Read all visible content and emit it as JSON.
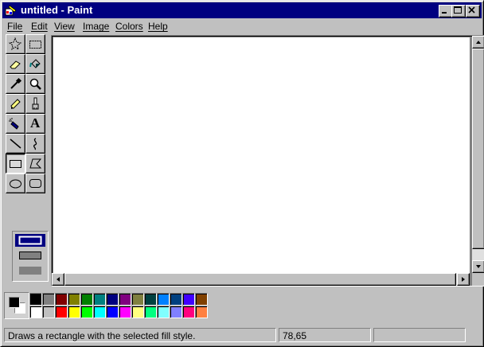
{
  "window": {
    "title": "untitled - Paint",
    "colors": {
      "titlebar": "#000080",
      "face": "#c0c0c0",
      "canvas": "#ffffff"
    }
  },
  "menu": {
    "items": [
      {
        "label": "File",
        "id": "file"
      },
      {
        "label": "Edit",
        "id": "edit"
      },
      {
        "label": "View",
        "id": "view"
      },
      {
        "label": "Image",
        "id": "image"
      },
      {
        "label": "Colors",
        "id": "colors"
      },
      {
        "label": "Help",
        "id": "help"
      }
    ]
  },
  "tools": [
    {
      "name": "free-form-select",
      "icon": "free-form-select-icon"
    },
    {
      "name": "select",
      "icon": "rect-select-icon"
    },
    {
      "name": "eraser",
      "icon": "eraser-icon"
    },
    {
      "name": "fill-with-color",
      "icon": "paint-bucket-icon"
    },
    {
      "name": "pick-color",
      "icon": "eyedropper-icon"
    },
    {
      "name": "magnifier",
      "icon": "magnifier-icon"
    },
    {
      "name": "pencil",
      "icon": "pencil-icon"
    },
    {
      "name": "brush",
      "icon": "brush-icon"
    },
    {
      "name": "airbrush",
      "icon": "airbrush-icon"
    },
    {
      "name": "text",
      "icon": "text-icon",
      "glyph": "A"
    },
    {
      "name": "line",
      "icon": "line-icon"
    },
    {
      "name": "curve",
      "icon": "curve-icon"
    },
    {
      "name": "rectangle",
      "icon": "rectangle-icon",
      "selected": true
    },
    {
      "name": "polygon",
      "icon": "polygon-icon"
    },
    {
      "name": "ellipse",
      "icon": "ellipse-icon"
    },
    {
      "name": "rounded-rectangle",
      "icon": "rounded-rectangle-icon"
    }
  ],
  "fill_styles": [
    "outline",
    "outline-filled",
    "filled"
  ],
  "selected_fill_style": "outline",
  "colors": {
    "foreground": "#000000",
    "background": "#ffffff",
    "palette_top": [
      "#000000",
      "#808080",
      "#800000",
      "#808000",
      "#008000",
      "#008080",
      "#000080",
      "#800080",
      "#808040",
      "#004040",
      "#0080ff",
      "#004080",
      "#4000ff",
      "#804000"
    ],
    "palette_bottom": [
      "#ffffff",
      "#c0c0c0",
      "#ff0000",
      "#ffff00",
      "#00ff00",
      "#00ffff",
      "#0000ff",
      "#ff00ff",
      "#ffff80",
      "#00ff80",
      "#80ffff",
      "#8080ff",
      "#ff0080",
      "#ff8040"
    ]
  },
  "status": {
    "message": "Draws a rectangle with the selected fill style.",
    "coordinates": "78,65",
    "size": ""
  }
}
